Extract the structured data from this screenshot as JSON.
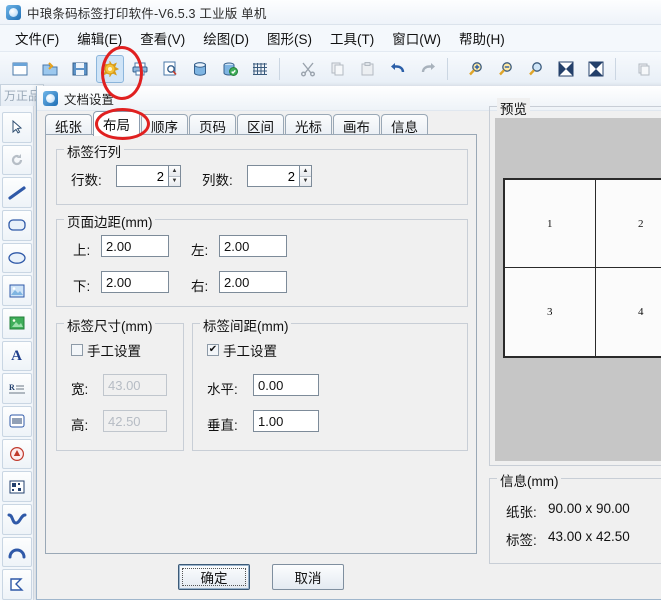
{
  "window": {
    "title": "中琅条码标签打印软件-V6.5.3 工业版 单机",
    "app_icon": "app-logo-icon"
  },
  "menubar": {
    "items": [
      {
        "label": "文件(F)",
        "key": "F"
      },
      {
        "label": "编辑(E)",
        "key": "E"
      },
      {
        "label": "查看(V)",
        "key": "V"
      },
      {
        "label": "绘图(D)",
        "key": "D"
      },
      {
        "label": "图形(S)",
        "key": "S"
      },
      {
        "label": "工具(T)",
        "key": "T"
      },
      {
        "label": "窗口(W)",
        "key": "W"
      },
      {
        "label": "帮助(H)",
        "key": "H"
      }
    ]
  },
  "toolbar": {
    "buttons": [
      {
        "icon": "new-document-icon",
        "active": false
      },
      {
        "icon": "open-folder-icon",
        "active": false
      },
      {
        "icon": "save-disk-icon",
        "active": false
      },
      {
        "icon": "document-settings-icon",
        "active": true
      },
      {
        "icon": "print-icon",
        "active": false
      },
      {
        "icon": "print-preview-icon",
        "active": false
      },
      {
        "icon": "database-icon",
        "active": false
      },
      {
        "icon": "database-connect-icon",
        "active": false
      },
      {
        "icon": "grid-icon",
        "active": false
      },
      {
        "icon": "cut-scissors-icon",
        "active": false
      },
      {
        "icon": "copy-icon",
        "active": false
      },
      {
        "icon": "paste-icon",
        "active": false
      },
      {
        "icon": "undo-icon",
        "active": false
      },
      {
        "icon": "redo-icon",
        "active": false
      },
      {
        "icon": "zoom-in-icon",
        "active": false
      },
      {
        "icon": "zoom-out-icon",
        "active": false
      },
      {
        "icon": "zoom-fit-icon",
        "active": false
      },
      {
        "icon": "align-center-icon",
        "active": false
      },
      {
        "icon": "align-middle-icon",
        "active": false
      },
      {
        "icon": "properties-icon",
        "active": false
      }
    ]
  },
  "left_toolbar": {
    "corner_tab_label": "万正品",
    "tools": [
      {
        "icon": "select-arrow-icon"
      },
      {
        "icon": "rotate-icon"
      },
      {
        "icon": "line-tool-icon"
      },
      {
        "icon": "rounded-rect-tool-icon"
      },
      {
        "icon": "ellipse-tool-icon"
      },
      {
        "icon": "image-tool-icon"
      },
      {
        "icon": "image-variable-tool-icon"
      },
      {
        "icon": "text-tool-icon"
      },
      {
        "icon": "rich-text-tool-icon"
      },
      {
        "icon": "barcode-tool-icon"
      },
      {
        "icon": "shape-tool-icon"
      },
      {
        "icon": "qrcode-tool-icon"
      },
      {
        "icon": "curve-tool-icon"
      },
      {
        "icon": "arc-tool-icon"
      },
      {
        "icon": "polygon-tool-icon"
      }
    ]
  },
  "dialog": {
    "title": "文档设置",
    "close_label": "✕",
    "tabs": [
      {
        "label": "纸张",
        "selected": false
      },
      {
        "label": "布局",
        "selected": true
      },
      {
        "label": "顺序",
        "selected": false
      },
      {
        "label": "页码",
        "selected": false
      },
      {
        "label": "区间",
        "selected": false
      },
      {
        "label": "光标",
        "selected": false
      },
      {
        "label": "画布",
        "selected": false
      },
      {
        "label": "信息",
        "selected": false
      }
    ],
    "rows_cols_group": {
      "legend": "标签行列",
      "rows_label": "行数:",
      "rows_value": "2",
      "cols_label": "列数:",
      "cols_value": "2"
    },
    "margins_group": {
      "legend": "页面边距(mm)",
      "top_label": "上:",
      "top_value": "2.00",
      "left_label": "左:",
      "left_value": "2.00",
      "bottom_label": "下:",
      "bottom_value": "2.00",
      "right_label": "右:",
      "right_value": "2.00"
    },
    "label_size_group": {
      "legend": "标签尺寸(mm)",
      "manual_label": "手工设置",
      "manual_checked": false,
      "width_label": "宽:",
      "width_value": "43.00",
      "height_label": "高:",
      "height_value": "42.50"
    },
    "label_gap_group": {
      "legend": "标签间距(mm)",
      "manual_label": "手工设置",
      "manual_checked": true,
      "horizontal_label": "水平:",
      "horizontal_value": "0.00",
      "vertical_label": "垂直:",
      "vertical_value": "1.00"
    },
    "preview": {
      "legend": "预览",
      "cells": [
        "1",
        "2",
        "3",
        "4"
      ]
    },
    "info": {
      "legend": "信息(mm)",
      "paper_label": "纸张:",
      "paper_value": "90.00 x 90.00",
      "label_label": "标签:",
      "label_value": "43.00 x 42.50"
    },
    "ok_label": "确定",
    "cancel_label": "取消"
  },
  "annotations": {
    "color": "#e02020",
    "marks": [
      {
        "name": "document-settings-toolbar-highlight"
      },
      {
        "name": "layout-tab-highlight"
      }
    ]
  }
}
